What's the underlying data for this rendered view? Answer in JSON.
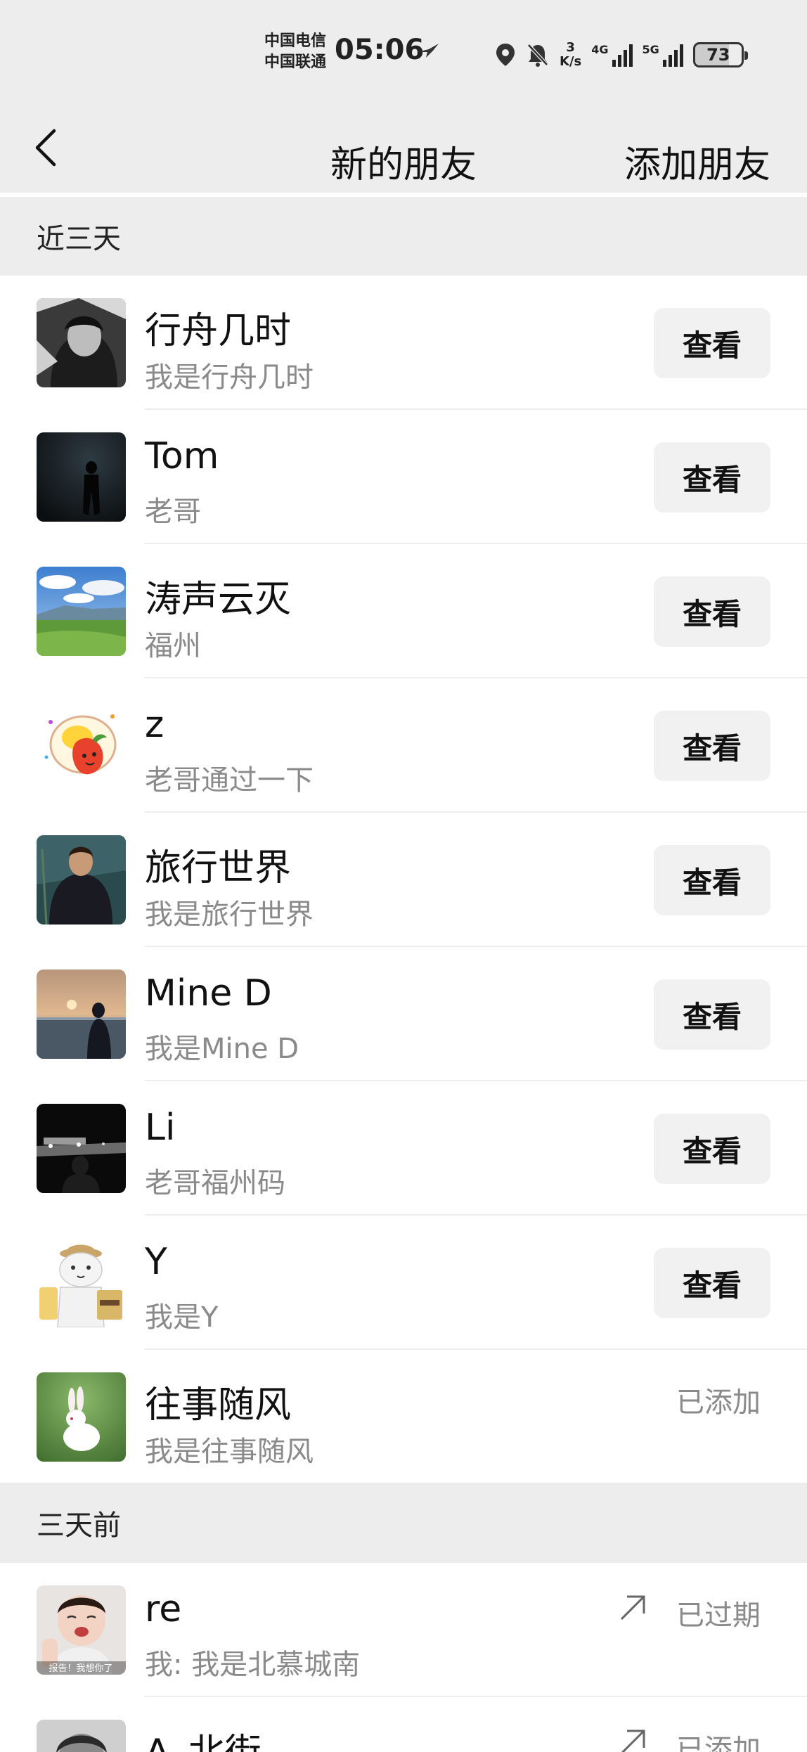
{
  "status_bar": {
    "carrier_1": "中国电信",
    "carrier_2": "中国联通",
    "time": "05:06",
    "speed_value": "3",
    "speed_unit": "K/s",
    "net_1": "4G",
    "net_2": "5G",
    "battery": "73"
  },
  "nav": {
    "title": "新的朋友",
    "add_friend": "添加朋友"
  },
  "sections": {
    "recent": "近三天",
    "earlier": "三天前"
  },
  "recent_items": [
    {
      "name": "行舟几时",
      "message": "我是行舟几时",
      "action": "查看"
    },
    {
      "name": "Tom",
      "message": "老哥",
      "action": "查看"
    },
    {
      "name": "涛声云灭",
      "message": "福州",
      "action": "查看"
    },
    {
      "name": "z",
      "message": "老哥通过一下",
      "action": "查看"
    },
    {
      "name": "旅行世界",
      "message": "我是旅行世界",
      "action": "查看"
    },
    {
      "name": "Mine D",
      "message": "我是Mine D",
      "action": "查看"
    },
    {
      "name": "Li",
      "message": "老哥福州码",
      "action": "查看"
    },
    {
      "name": "Y",
      "message": "我是Y",
      "action": "查看"
    },
    {
      "name": "往事随风",
      "message": "我是往事随风",
      "status": "已添加"
    }
  ],
  "earlier_items": [
    {
      "name": "re",
      "message": "我: 我是北慕城南",
      "status": "已过期"
    },
    {
      "name": "A_北街",
      "message": "",
      "status": "已添加"
    }
  ],
  "avatar_text": {
    "re": "报告！我想你了"
  },
  "colors": {
    "background_gray": "#ededed",
    "button_bg": "#f1f1f1",
    "secondary_text": "#8a8a8a"
  }
}
